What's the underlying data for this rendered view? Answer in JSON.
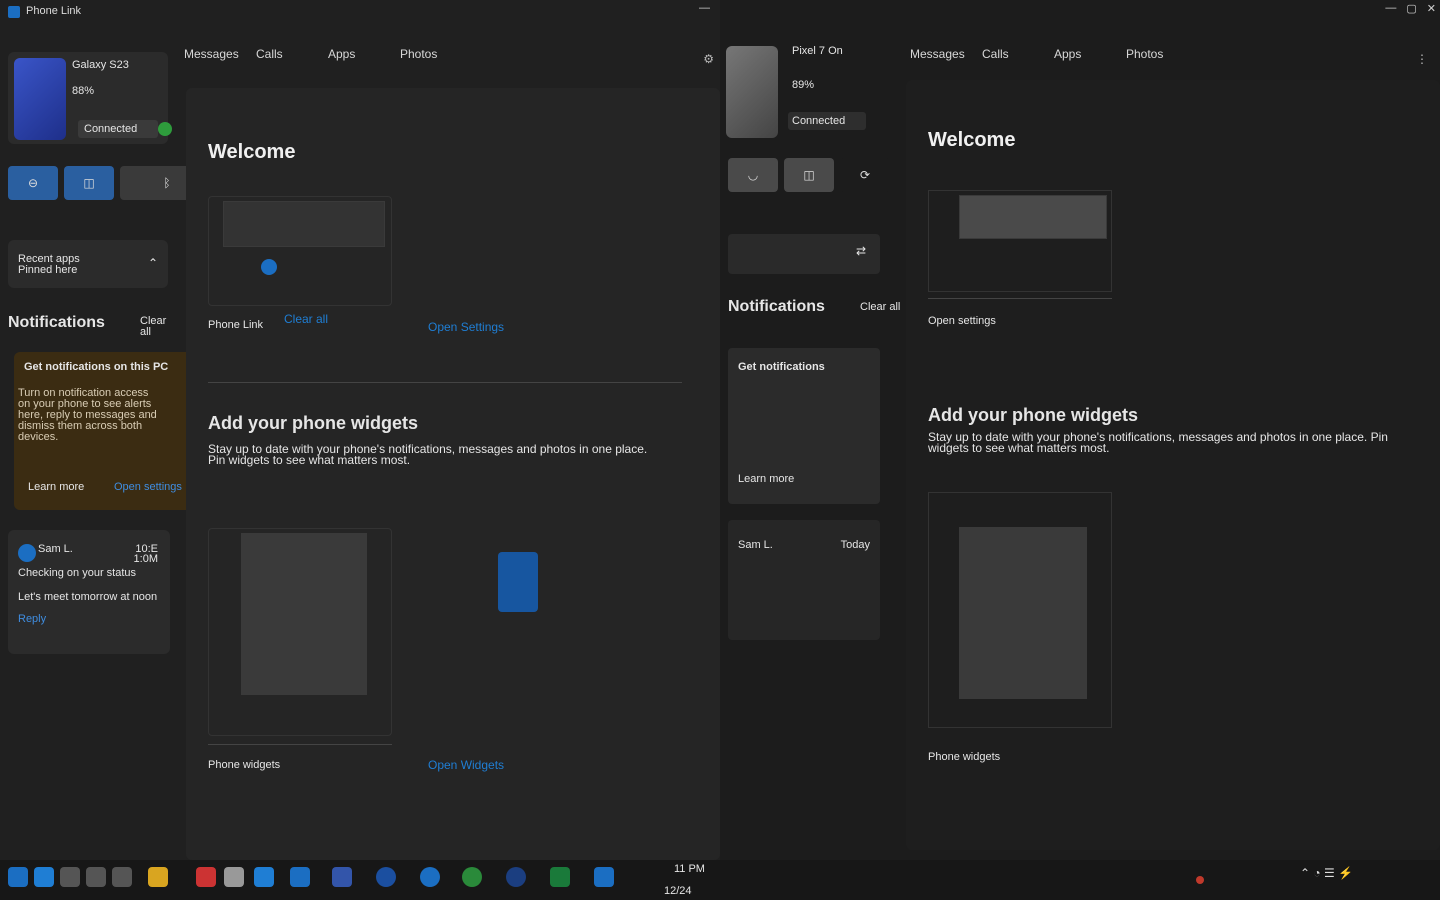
{
  "left": {
    "app_title": "Phone Link",
    "window_controls": [
      "—",
      "▢",
      "✕"
    ],
    "phone": {
      "name": "Galaxy S23",
      "battery": "88%",
      "status": "Connected"
    },
    "tabs": [
      "Messages",
      "Calls",
      "Apps",
      "Photos"
    ],
    "quick_actions": [
      "mute",
      "do-not-disturb",
      "bluetooth"
    ],
    "recent_apps_card": {
      "title": "Recent apps",
      "subtitle": "Pinned here"
    },
    "notifications": {
      "title": "Notifications",
      "clear_all": "Clear all"
    },
    "notif_card": {
      "title": "Get notifications on this PC",
      "body": "Turn on notification access on your phone to see alerts here, reply to messages and dismiss them across both devices.",
      "action": "Learn more",
      "action2": "Open settings"
    },
    "main": {
      "section1_title": "Welcome",
      "section1_caption": "Phone Link",
      "section1_link": "Clear all",
      "section1_link2": "Open Settings",
      "section2_title": "Add your phone widgets",
      "section2_body": "Stay up to date with your phone's notifications, messages and photos in one place. Pin widgets to see what matters most.",
      "section3_caption": "Phone widgets",
      "section3_link": "Open Widgets"
    },
    "message": {
      "sender": "Sam L.",
      "time": "10:E",
      "time2": "1:0M",
      "preview_title": "Checking on your status",
      "preview_body": "Let's meet tomorrow at noon",
      "link": "Reply"
    }
  },
  "right": {
    "tabs": [
      "Messages",
      "Calls",
      "Apps",
      "Photos"
    ],
    "phone": {
      "name": "Pixel 7 On",
      "battery": "89%",
      "status": "Connected"
    },
    "section_title": "Welcome",
    "notifications_title": "Notifications",
    "clear_label": "Clear all",
    "section2_title": "Add your phone widgets",
    "section2_body": "Stay up to date with your phone's notifications, messages and photos in one place. Pin widgets to see what matters most.",
    "caption1": "Open settings",
    "caption2": "Phone widgets",
    "card_title": "Get notifications",
    "card_action": "Learn more",
    "message_sender": "Sam L.",
    "message_time": "Today"
  },
  "taskbar": {
    "time": "11 PM",
    "date": "12/24",
    "accent": "#1b6ec2"
  }
}
